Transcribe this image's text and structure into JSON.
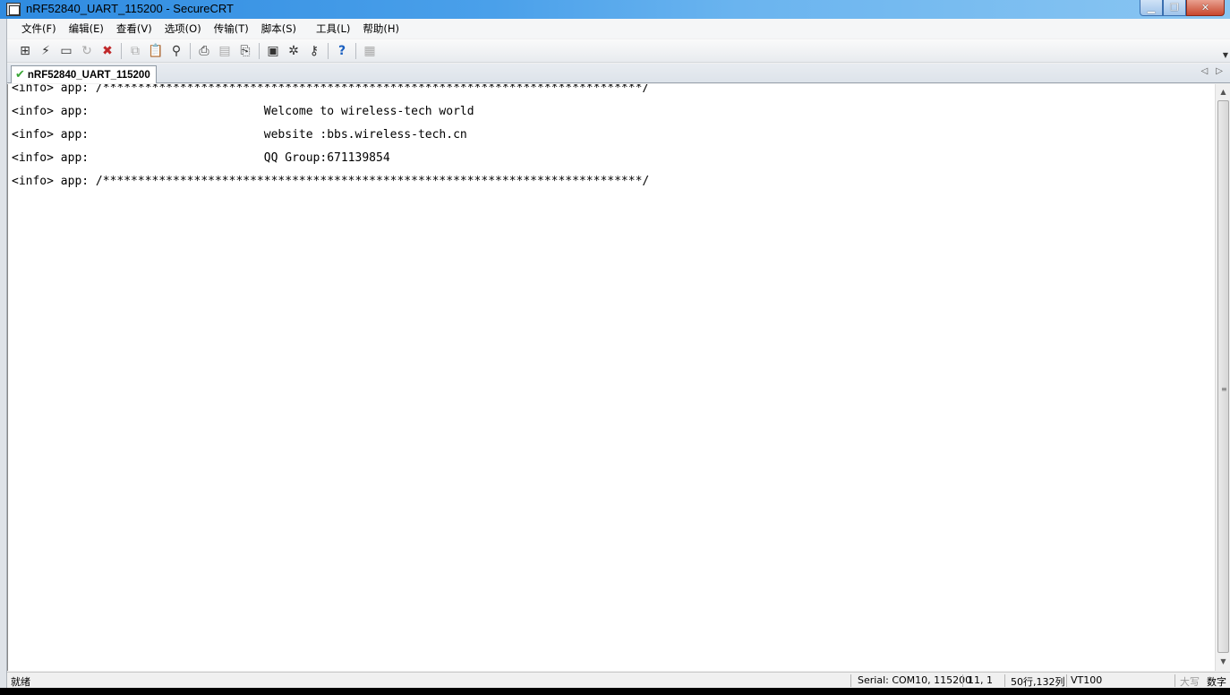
{
  "window": {
    "title": "nRF52840_UART_115200 - SecureCRT",
    "minimize_glyph": "▁",
    "maximize_glyph": "❐",
    "close_glyph": "✕"
  },
  "menu": [
    "文件(F)",
    "编辑(E)",
    "查看(V)",
    "选项(O)",
    "传输(T)",
    "脚本(S)",
    "工具(L)",
    "帮助(H)"
  ],
  "toolbar": {
    "icons": [
      "connect-icon",
      "quick-connect-icon",
      "connect-tab-icon",
      "reconnect-icon",
      "disconnect-icon",
      "copy-icon",
      "paste-icon",
      "find-icon",
      "print-icon",
      "print-setup-icon",
      "print-screen-icon",
      "session-options-icon",
      "global-options-icon",
      "keymap-icon",
      "help-icon",
      "sftp-icon"
    ]
  },
  "tab": {
    "label": "nRF52840_UART_115200",
    "status": "connected"
  },
  "terminal": {
    "lines": [
      "<info> app: /*****************************************************************************/",
      "<info> app:                         Welcome to wireless-tech world",
      "<info> app:                         website :bbs.wireless-tech.cn",
      "<info> app:                         QQ Group:671139854",
      "<info> app: /*****************************************************************************/"
    ]
  },
  "statusbar": {
    "ready": "就绪",
    "connection": "Serial: COM10, 115200",
    "cursor": "11,  1",
    "size": "50行,132列",
    "emulation": "VT100",
    "caps": "大写",
    "num": "数字"
  },
  "colors": {
    "title_gradient_start": "#2f8be0",
    "tab_check": "#3aa636",
    "terminal_bg": "#ffffff"
  }
}
